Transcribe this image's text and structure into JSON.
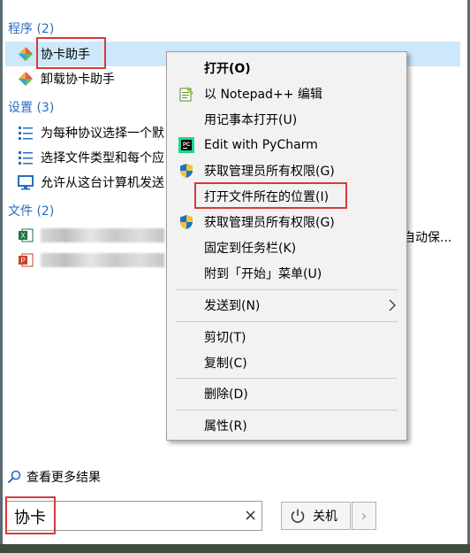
{
  "sections": {
    "programs": {
      "title": "程序 (2)",
      "items": [
        {
          "label": "协卡助手",
          "icon": "app-icon"
        },
        {
          "label": "卸载协卡助手",
          "icon": "app-icon"
        }
      ]
    },
    "settings": {
      "title": "设置 (3)",
      "items": [
        {
          "label": "为每种协议选择一个默",
          "icon": "list-settings-icon"
        },
        {
          "label": "选择文件类型和每个应",
          "icon": "list-settings-icon"
        },
        {
          "label": "允许从这台计算机发送",
          "icon": "monitor-icon"
        }
      ]
    },
    "files": {
      "title": "文件 (2)",
      "items": [
        {
          "icon": "excel-icon",
          "suffix": "自动保..."
        },
        {
          "icon": "powerpoint-icon"
        }
      ]
    }
  },
  "context_menu": {
    "items": [
      {
        "label": "打开(O)",
        "bold": true
      },
      {
        "label": "以 Notepad++ 编辑",
        "icon": "notepad-plus-plus-icon"
      },
      {
        "label": "用记事本打开(U)"
      },
      {
        "label": "Edit with PyCharm",
        "icon": "pycharm-icon"
      },
      {
        "label": "获取管理员所有权限(G)",
        "icon": "uac-shield-icon"
      },
      {
        "label": "打开文件所在的位置(I)",
        "highlighted": true
      },
      {
        "label": "获取管理员所有权限(G)",
        "icon": "uac-shield-icon"
      },
      {
        "label": "固定到任务栏(K)"
      },
      {
        "label": "附到「开始」菜单(U)"
      },
      {
        "label": "发送到(N)",
        "submenu": true
      },
      {
        "label": "剪切(T)"
      },
      {
        "label": "复制(C)"
      },
      {
        "label": "删除(D)"
      },
      {
        "label": "属性(R)"
      }
    ]
  },
  "more_results": "查看更多结果",
  "search": {
    "value": "协卡",
    "clear_glyph": "×"
  },
  "power_button": {
    "label": "关机",
    "arrow": "›"
  },
  "colors": {
    "accent": "#2a6cc1",
    "selection": "#cde8fb",
    "highlight_border": "#d83a3a"
  }
}
